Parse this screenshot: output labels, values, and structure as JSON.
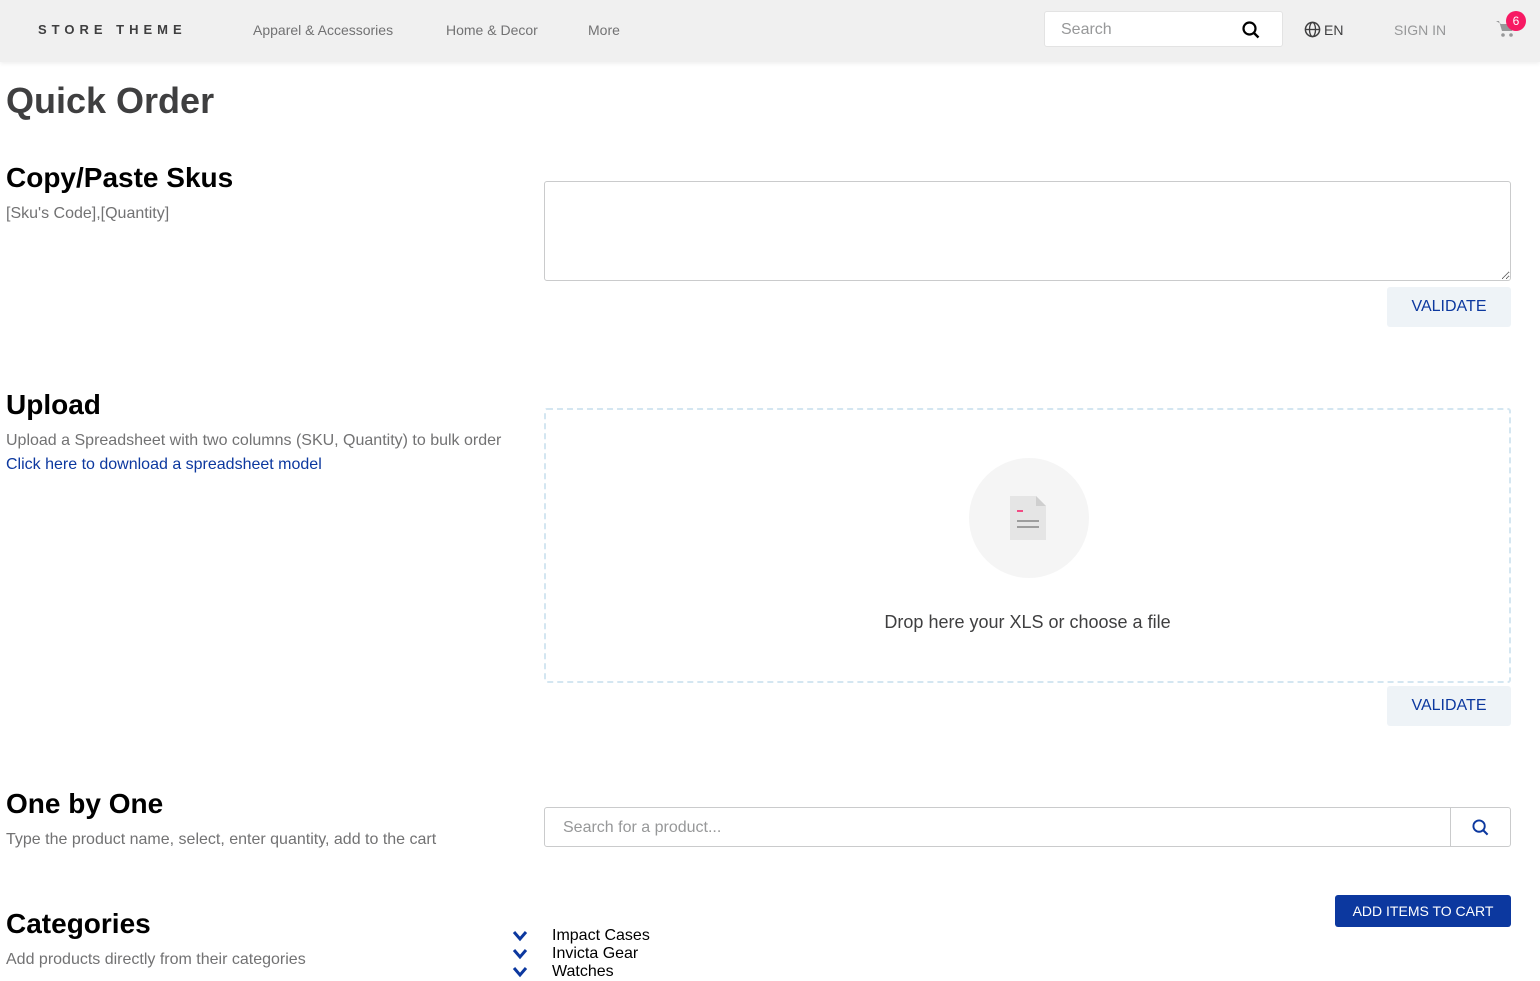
{
  "header": {
    "logo": "STORE THEME",
    "nav": [
      "Apparel & Accessories",
      "Home & Decor",
      "More"
    ],
    "search_placeholder": "Search",
    "language": "EN",
    "sign_in": "SIGN IN",
    "cart_count": "6",
    "badge_color": "#f71963"
  },
  "page_title": "Quick Order",
  "copy_paste": {
    "title": "Copy/Paste Skus",
    "desc": "[Sku's Code],[Quantity]",
    "validate": "VALIDATE"
  },
  "upload": {
    "title": "Upload",
    "desc": "Upload a Spreadsheet with two columns (SKU, Quantity) to bulk order",
    "link": "Click here to download a spreadsheet model",
    "drop_text": "Drop here your XLS or choose a file",
    "validate": "VALIDATE"
  },
  "one_by_one": {
    "title": "One by One",
    "desc": "Type the product name, select, enter quantity, add to the cart",
    "search_placeholder": "Search for a product..."
  },
  "add_to_cart": "ADD ITEMS TO CART",
  "categories": {
    "title": "Categories",
    "desc": "Add products directly from their categories",
    "items": [
      "Impact Cases",
      "Invicta Gear",
      "Watches"
    ]
  },
  "accent_color": "#0c389f"
}
